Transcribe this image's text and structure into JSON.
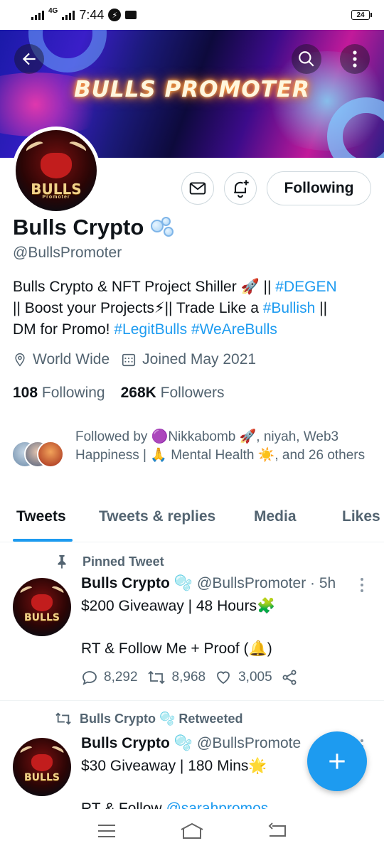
{
  "status_bar": {
    "network": "4G",
    "time": "7:44",
    "battery": "24"
  },
  "banner": {
    "title": "BULLS PROMOTER"
  },
  "avatar": {
    "word": "BULLS",
    "sub": "Promoter"
  },
  "actions": {
    "following_label": "Following"
  },
  "profile": {
    "display_name": "Bulls Crypto",
    "username": "@BullsPromoter",
    "bio": {
      "line1_text": "Bulls Crypto & NFT Project Shiller 🚀 || ",
      "line1_tag": "#DEGEN",
      "line2_text": "|| Boost your Projects⚡|| Trade Like a ",
      "line2_tag": "#Bullish",
      "line2_end": " ||",
      "line3_text": "DM for Promo! ",
      "line3_tag1": "#LegitBulls",
      "line3_tag2": "#WeAreBulls"
    },
    "location": "World Wide",
    "joined": "Joined May 2021",
    "following_count": "108",
    "following_label": "Following",
    "followers_count": "268K",
    "followers_label": "Followers",
    "followed_by": "Followed by 🟣Nikkabomb 🚀, niyah, Web3 Happiness | 🙏 Mental Health ☀️, and 26 others"
  },
  "tabs": [
    "Tweets",
    "Tweets & replies",
    "Media",
    "Likes"
  ],
  "tweets": [
    {
      "context": "Pinned Tweet",
      "name": "Bulls Crypto",
      "handle": "@BullsPromoter · 5h",
      "line1": "$200 Giveaway | 48 Hours🧩",
      "line2": "RT & Follow Me + Proof (🔔)",
      "replies": "8,292",
      "retweets": "8,968",
      "likes": "3,005"
    },
    {
      "context": "Bulls Crypto 🫧 Retweeted",
      "name": "Bulls Crypto",
      "handle": "@BullsPromote",
      "line1": "$30 Giveaway | 180 Mins🌟",
      "line2_text": "RT & Follow ",
      "line2_link": "@sarahpromos"
    }
  ],
  "colors": {
    "accent": "#1d9bf0",
    "muted": "#536471",
    "text": "#0f1419",
    "border": "#cfd9de"
  }
}
